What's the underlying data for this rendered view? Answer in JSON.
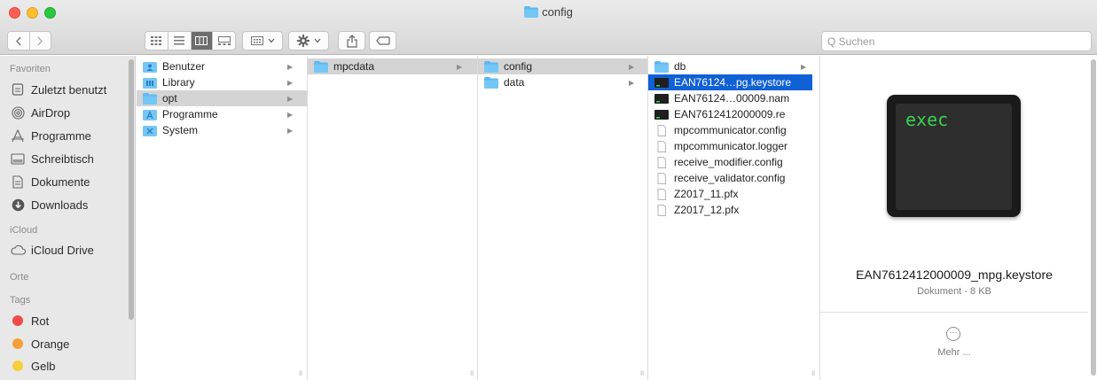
{
  "window": {
    "title": "config"
  },
  "search": {
    "placeholder": "Q Suchen"
  },
  "sidebar": {
    "favorites_header": "Favoriten",
    "favorites": [
      {
        "label": "Zuletzt benutzt",
        "icon": "recents-icon"
      },
      {
        "label": "AirDrop",
        "icon": "airdrop-icon"
      },
      {
        "label": "Programme",
        "icon": "applications-icon"
      },
      {
        "label": "Schreibtisch",
        "icon": "desktop-icon"
      },
      {
        "label": "Dokumente",
        "icon": "documents-icon"
      },
      {
        "label": "Downloads",
        "icon": "downloads-icon"
      }
    ],
    "icloud_header": "iCloud",
    "icloud": [
      {
        "label": "iCloud Drive",
        "icon": "cloud-icon"
      }
    ],
    "places_header": "Orte",
    "tags_header": "Tags",
    "tags": [
      {
        "label": "Rot",
        "color": "#f14b48"
      },
      {
        "label": "Orange",
        "color": "#f3a03a"
      },
      {
        "label": "Gelb",
        "color": "#f6cf3a"
      }
    ]
  },
  "columns": [
    {
      "items": [
        "Benutzer",
        "Library",
        "opt",
        "Programme",
        "System"
      ]
    },
    {
      "items": [
        "mpcdata"
      ]
    },
    {
      "items": [
        "config",
        "data"
      ]
    },
    {
      "items": [
        "db",
        "EAN76124…pg.keystore",
        "EAN76124…00009.nam",
        "EAN7612412000009.re",
        "mpcommunicator.config",
        "mpcommunicator.logger",
        "receive_modifier.config",
        "receive_validator.config",
        "Z2017_11.pfx",
        "Z2017_12.pfx"
      ]
    }
  ],
  "preview": {
    "icon_text": "exec",
    "filename": "EAN7612412000009_mpg.keystore",
    "kind": "Dokument - 8 KB",
    "more_label": "Mehr ..."
  },
  "colors": {
    "selection_blue": "#1060d6",
    "selection_gray": "#d4d4d4",
    "folder_blue": "#5cb8f2",
    "exec_green": "#3ad24f"
  }
}
